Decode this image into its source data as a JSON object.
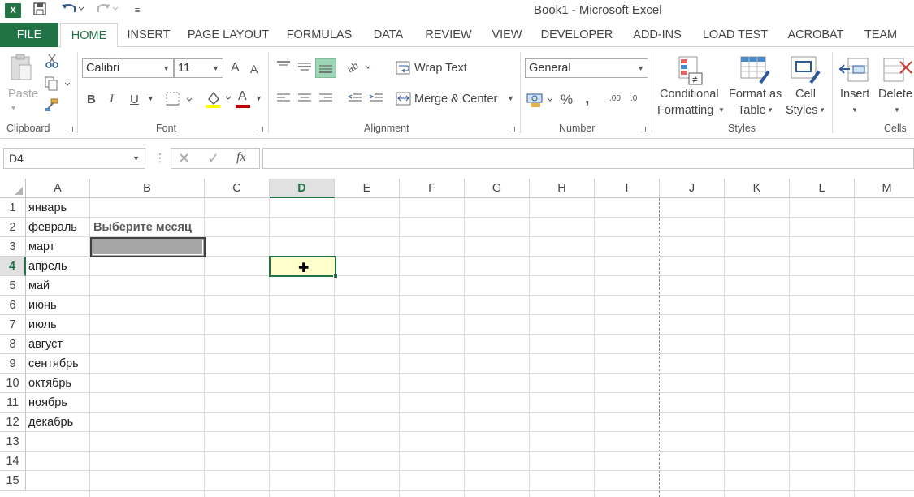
{
  "titlebar": {
    "title": "Book1 - Microsoft Excel",
    "logo": "X",
    "icons": [
      "excel-logo-icon",
      "save-icon",
      "undo-icon",
      "redo-icon",
      "customize-icon"
    ]
  },
  "tabs": [
    {
      "label": "FILE"
    },
    {
      "label": "HOME"
    },
    {
      "label": "INSERT"
    },
    {
      "label": "PAGE LAYOUT"
    },
    {
      "label": "FORMULAS"
    },
    {
      "label": "DATA"
    },
    {
      "label": "REVIEW"
    },
    {
      "label": "VIEW"
    },
    {
      "label": "DEVELOPER"
    },
    {
      "label": "ADD-INS"
    },
    {
      "label": "LOAD TEST"
    },
    {
      "label": "ACROBAT"
    },
    {
      "label": "TEAM"
    }
  ],
  "ribbon": {
    "clipboard": {
      "label": "Clipboard",
      "paste": "Paste"
    },
    "font": {
      "label": "Font",
      "family": "Calibri",
      "size": "11",
      "bold": "B",
      "italic": "I",
      "underline": "U",
      "grow": "A",
      "shrink": "A",
      "color": "A"
    },
    "alignment": {
      "label": "Alignment",
      "wrap": "Wrap Text",
      "merge": "Merge & Center"
    },
    "number": {
      "label": "Number",
      "format": "General",
      "percent": "%",
      "comma": ",",
      "inc": ".00",
      "dec": ".0"
    },
    "styles": {
      "label": "Styles",
      "conditional_1": "Conditional",
      "conditional_2": "Formatting",
      "format_table_1": "Format as",
      "format_table_2": "Table",
      "cell_styles_1": "Cell",
      "cell_styles_2": "Styles"
    },
    "cells": {
      "label": "Cells",
      "insert": "Insert",
      "delete": "Delete"
    }
  },
  "formula_bar": {
    "name_box": "D4",
    "fx": "fx",
    "value": ""
  },
  "sheet": {
    "columns": [
      "A",
      "B",
      "C",
      "D",
      "E",
      "F",
      "G",
      "H",
      "I",
      "J",
      "K",
      "L",
      "M"
    ],
    "selected_column": "D",
    "rows": [
      "1",
      "2",
      "3",
      "4",
      "5",
      "6",
      "7",
      "8",
      "9",
      "10",
      "11",
      "12",
      "13",
      "14",
      "15"
    ],
    "selected_row": "4",
    "col_a": [
      "январь",
      "февраль",
      "март",
      "апрель",
      "май",
      "июнь",
      "июль",
      "август",
      "сентябрь",
      "октябрь",
      "ноябрь",
      "декабрь"
    ],
    "b2": "Выберите месяц",
    "colors": {
      "accent": "#217346",
      "b3_fill": "#a6a6a6",
      "d4_fill": "#ffffcc",
      "select_header": "#e1e1e1"
    }
  }
}
